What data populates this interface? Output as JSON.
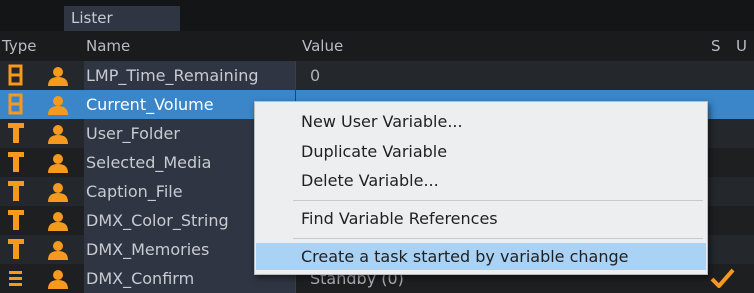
{
  "window": {
    "tab_label": "Lister"
  },
  "columns": {
    "type": "Type",
    "name": "Name",
    "value": "Value",
    "s": "S",
    "u": "U"
  },
  "colors": {
    "selected_row": "#3a86c8",
    "icon_orange": "#f59a1f",
    "menu_highlight": "#a9d2f4",
    "check_orange": "#f59a1f"
  },
  "rows": [
    {
      "type_icon": "number-icon",
      "name": "LMP_Time_Remaining",
      "value": "0",
      "selected": false,
      "checked": false
    },
    {
      "type_icon": "number-icon",
      "name": "Current_Volume",
      "value": "",
      "selected": true,
      "checked": false
    },
    {
      "type_icon": "text-icon",
      "name": "User_Folder",
      "value": "",
      "selected": false,
      "checked": false
    },
    {
      "type_icon": "text-icon",
      "name": "Selected_Media",
      "value": "",
      "selected": false,
      "checked": false
    },
    {
      "type_icon": "text-icon",
      "name": "Caption_File",
      "value": "",
      "selected": false,
      "checked": false
    },
    {
      "type_icon": "text-icon",
      "name": "DMX_Color_String",
      "value": "",
      "selected": false,
      "checked": false
    },
    {
      "type_icon": "text-icon",
      "name": "DMX_Memories",
      "value": "",
      "selected": false,
      "checked": false
    },
    {
      "type_icon": "list-icon",
      "name": "DMX_Confirm",
      "value": "Standby (0)",
      "selected": false,
      "checked": true
    }
  ],
  "context_menu": {
    "items": [
      {
        "label": "New User Variable...",
        "highlighted": false
      },
      {
        "label": "Duplicate Variable",
        "highlighted": false
      },
      {
        "label": "Delete Variable...",
        "highlighted": false
      },
      {
        "label": "Find Variable References",
        "highlighted": false
      },
      {
        "label": "Create a task started by variable change",
        "highlighted": true
      }
    ]
  }
}
